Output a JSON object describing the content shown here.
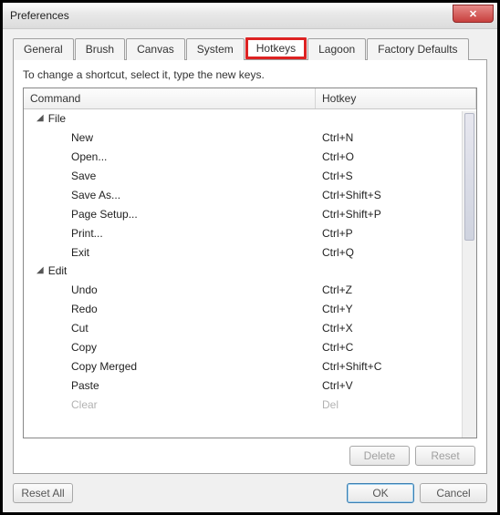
{
  "window": {
    "title": "Preferences"
  },
  "tabs": {
    "items": [
      {
        "label": "General"
      },
      {
        "label": "Brush"
      },
      {
        "label": "Canvas"
      },
      {
        "label": "System"
      },
      {
        "label": "Hotkeys"
      },
      {
        "label": "Lagoon"
      },
      {
        "label": "Factory Defaults"
      }
    ]
  },
  "panel": {
    "instruction": "To change a shortcut, select it, type the new keys.",
    "headers": {
      "command": "Command",
      "hotkey": "Hotkey"
    },
    "groups": [
      {
        "name": "File",
        "items": [
          {
            "cmd": "New",
            "key": "Ctrl+N"
          },
          {
            "cmd": "Open...",
            "key": "Ctrl+O"
          },
          {
            "cmd": "Save",
            "key": "Ctrl+S"
          },
          {
            "cmd": "Save As...",
            "key": "Ctrl+Shift+S"
          },
          {
            "cmd": "Page Setup...",
            "key": "Ctrl+Shift+P"
          },
          {
            "cmd": "Print...",
            "key": "Ctrl+P"
          },
          {
            "cmd": "Exit",
            "key": "Ctrl+Q"
          }
        ]
      },
      {
        "name": "Edit",
        "items": [
          {
            "cmd": "Undo",
            "key": "Ctrl+Z"
          },
          {
            "cmd": "Redo",
            "key": "Ctrl+Y"
          },
          {
            "cmd": "Cut",
            "key": "Ctrl+X"
          },
          {
            "cmd": "Copy",
            "key": "Ctrl+C"
          },
          {
            "cmd": "Copy Merged",
            "key": "Ctrl+Shift+C"
          },
          {
            "cmd": "Paste",
            "key": "Ctrl+V"
          },
          {
            "cmd": "Clear",
            "key": "Del"
          }
        ]
      }
    ],
    "delete_label": "Delete",
    "reset_label": "Reset"
  },
  "footer": {
    "reset_all": "Reset All",
    "ok": "OK",
    "cancel": "Cancel"
  }
}
